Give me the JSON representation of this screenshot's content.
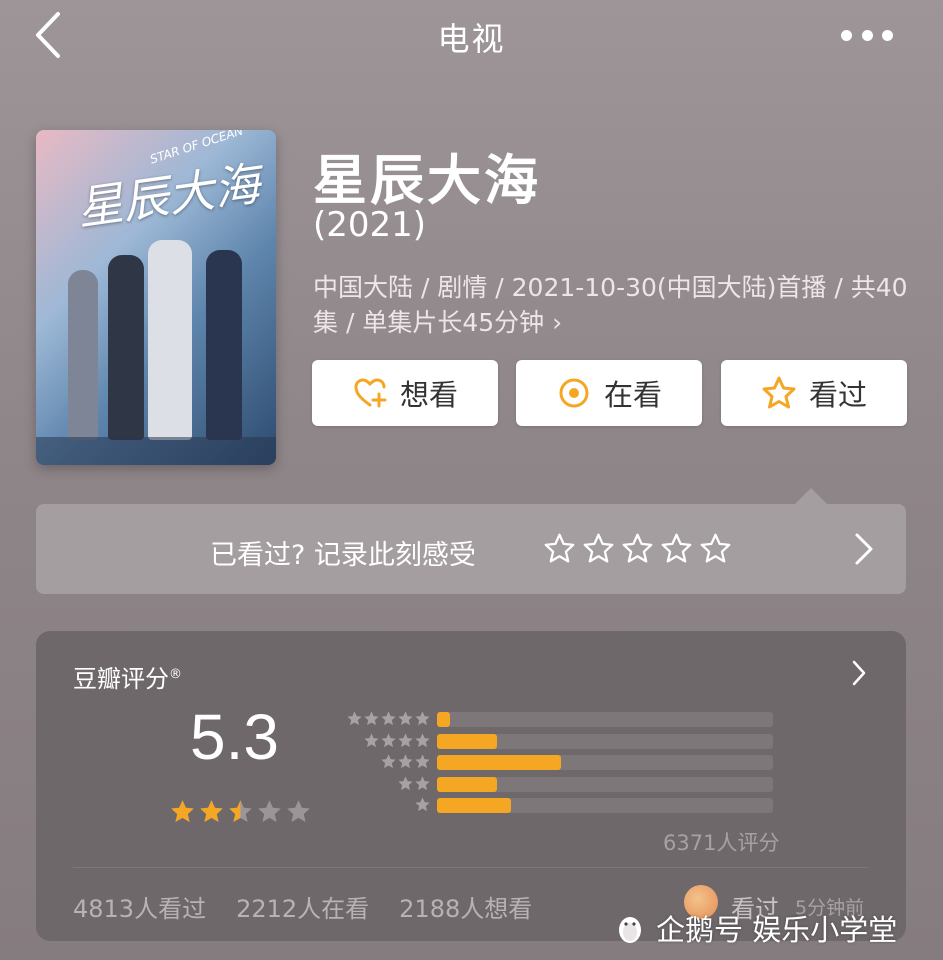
{
  "header": {
    "title": "电视"
  },
  "movie": {
    "title": "星辰大海",
    "year": "(2021)",
    "meta": "中国大陆 / 剧情 / 2021-10-30(中国大陆)首播 / 共40集 / 单集片长45分钟 ›",
    "poster_title": "星辰大海",
    "poster_subtitle": "STAR OF OCEAN"
  },
  "actions": [
    {
      "label": "想看",
      "icon": "heart-plus-icon"
    },
    {
      "label": "在看",
      "icon": "target-icon"
    },
    {
      "label": "看过",
      "icon": "star-outline-icon"
    }
  ],
  "record": {
    "text": "已看过? 记录此刻感受",
    "stars": 5
  },
  "rating": {
    "title": "豆瓣评分",
    "mark": "®",
    "score": "5.3",
    "stars_value": 2.5,
    "count_text": "6371人评分",
    "distribution": [
      {
        "stars": 5,
        "fraction": 0.04
      },
      {
        "stars": 4,
        "fraction": 0.18
      },
      {
        "stars": 3,
        "fraction": 0.37
      },
      {
        "stars": 2,
        "fraction": 0.18
      },
      {
        "stars": 1,
        "fraction": 0.22
      }
    ],
    "stats": {
      "watched": "4813人看过",
      "watching": "2212人在看",
      "want": "2188人想看"
    },
    "recent": {
      "label": "看过",
      "time": "5分钟前"
    }
  },
  "watermark": {
    "text": "企鹅号 娱乐小学堂"
  },
  "colors": {
    "accent": "#f5a623",
    "card": "#6f686b",
    "background": "#928a8d"
  }
}
